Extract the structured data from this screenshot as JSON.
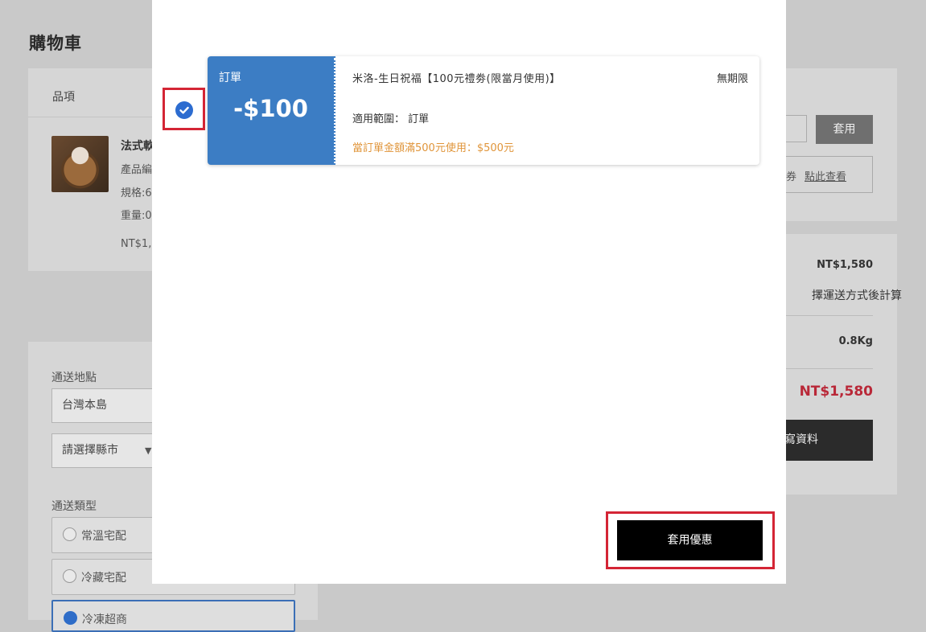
{
  "page": {
    "title": "購物車",
    "cart": {
      "column_label": "品項",
      "item": {
        "name": "法式軟",
        "lines": [
          "產品編",
          "規格:6",
          "重量:0"
        ],
        "price": "NT$1,"
      }
    },
    "promo": {
      "apply_label": "套用",
      "coupon_prefix": "券",
      "view_link": "點此查看"
    },
    "summary": {
      "subtotal": "NT$1,580",
      "shipping_note": "擇運送方式後計算",
      "weight": "0.8Kg",
      "total": "NT$1,580",
      "checkout_label": "寫資料"
    },
    "shipping": {
      "area_label": "通送地點",
      "area_value": "台灣本島",
      "city_placeholder": "請選擇縣市",
      "type_label": "通送類型",
      "options": [
        "常溫宅配",
        "冷藏宅配",
        "冷凍超商"
      ]
    }
  },
  "modal": {
    "coupon": {
      "type": "訂單",
      "amount": "-$100",
      "title": "米洛-生日祝福【100元禮劵(限當月使用)】",
      "expiry": "無期限",
      "scope_label": "適用範圍：",
      "scope_value": "訂單",
      "condition": "當訂單金額滿500元使用：$500元"
    },
    "apply_button": "套用優惠"
  },
  "colors": {
    "coupon_blue": "#3c7dc4",
    "highlight_red": "#d42535",
    "condition_orange": "#e0953a",
    "total_red": "#b92838"
  }
}
